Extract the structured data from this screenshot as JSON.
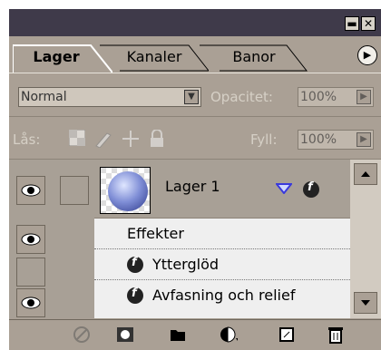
{
  "window": {
    "minimize_glyph": "▬",
    "close_glyph": "✕",
    "menu_glyph": "▶"
  },
  "tabs": [
    {
      "label": "Lager",
      "active": true
    },
    {
      "label": "Kanaler",
      "active": false
    },
    {
      "label": "Banor",
      "active": false
    }
  ],
  "blend": {
    "mode": "Normal",
    "opacity_label": "Opacitet:",
    "opacity_value": "100%"
  },
  "lock": {
    "label": "Lås:",
    "fill_label": "Fyll:",
    "fill_value": "100%"
  },
  "layer": {
    "name": "Lager 1"
  },
  "effects": {
    "header": "Effekter",
    "items": [
      "Ytterglöd",
      "Avfasning och relief"
    ]
  },
  "icons": {
    "eye": "eye-icon",
    "fx": "fx-icon",
    "collapse": "triangle-down-icon",
    "lock_transparency": "checker-lock-icon",
    "lock_paint": "brush-lock-icon",
    "lock_move": "move-lock-icon",
    "lock_all": "padlock-icon",
    "bottom": [
      "link-icon",
      "mask-icon",
      "folder-icon",
      "adjustment-icon",
      "new-layer-icon",
      "trash-icon"
    ]
  },
  "colors": {
    "panel": "#aaa095",
    "titlebar": "#3f3a4a",
    "list_bg": "#efefef",
    "accent_blue": "#3a3adc"
  }
}
